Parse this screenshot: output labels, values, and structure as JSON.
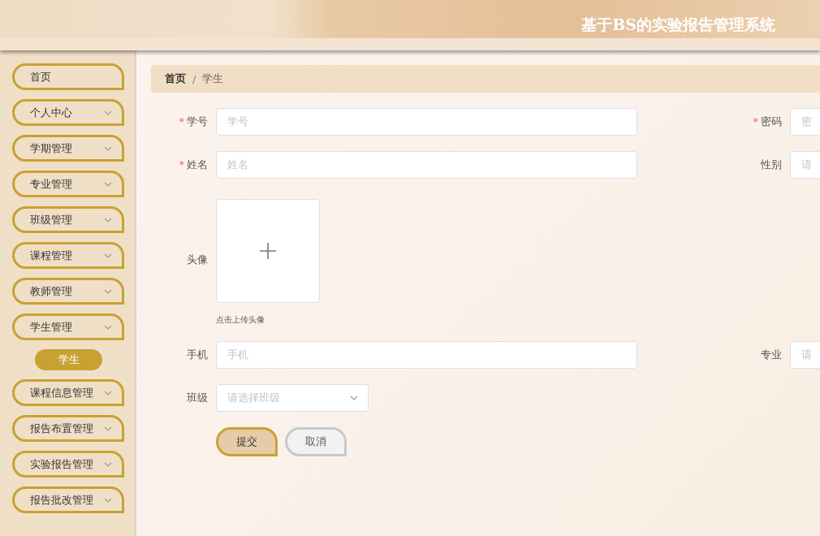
{
  "header": {
    "title": "基于BS的实验报告管理系统"
  },
  "sidebar": {
    "items": [
      {
        "label": "首页",
        "kind": "link"
      },
      {
        "label": "个人中心",
        "kind": "menu"
      },
      {
        "label": "学期管理",
        "kind": "menu"
      },
      {
        "label": "专业管理",
        "kind": "menu"
      },
      {
        "label": "班级管理",
        "kind": "menu"
      },
      {
        "label": "课程管理",
        "kind": "menu"
      },
      {
        "label": "教师管理",
        "kind": "menu"
      },
      {
        "label": "学生管理",
        "kind": "menu",
        "children": [
          {
            "label": "学生",
            "selected": true
          }
        ]
      },
      {
        "label": "课程信息管理",
        "kind": "menu"
      },
      {
        "label": "报告布置管理",
        "kind": "menu"
      },
      {
        "label": "实验报告管理",
        "kind": "menu"
      },
      {
        "label": "报告批改管理",
        "kind": "menu"
      }
    ]
  },
  "breadcrumb": [
    {
      "label": "首页"
    },
    {
      "label": "学生"
    }
  ],
  "breadcrumb_separator": "/",
  "form": {
    "rows": [
      {
        "kind": "pair",
        "fields": [
          {
            "label": "学号",
            "required_mark": "*",
            "placeholder": "学号",
            "kind": "text"
          },
          {
            "label": "密码",
            "required_mark": "*",
            "placeholder": "密",
            "kind": "text"
          }
        ]
      },
      {
        "kind": "pair",
        "fields": [
          {
            "label": "姓名",
            "required_mark": "*",
            "placeholder": "姓名",
            "kind": "text"
          },
          {
            "label": "性别",
            "placeholder": "请",
            "kind": "text"
          }
        ]
      },
      {
        "kind": "upload",
        "label": "头像",
        "caption": "点击上传头像"
      },
      {
        "kind": "pair",
        "fields": [
          {
            "label": "手机",
            "placeholder": "手机",
            "kind": "text"
          },
          {
            "label": "专业",
            "placeholder": "请",
            "kind": "text"
          }
        ]
      },
      {
        "kind": "pair",
        "fields": [
          {
            "label": "班级",
            "placeholder": "请选择班级",
            "kind": "select"
          }
        ]
      }
    ],
    "buttons": [
      {
        "label": "提交",
        "kind": "primary"
      },
      {
        "label": "取消",
        "kind": "secondary"
      }
    ]
  }
}
